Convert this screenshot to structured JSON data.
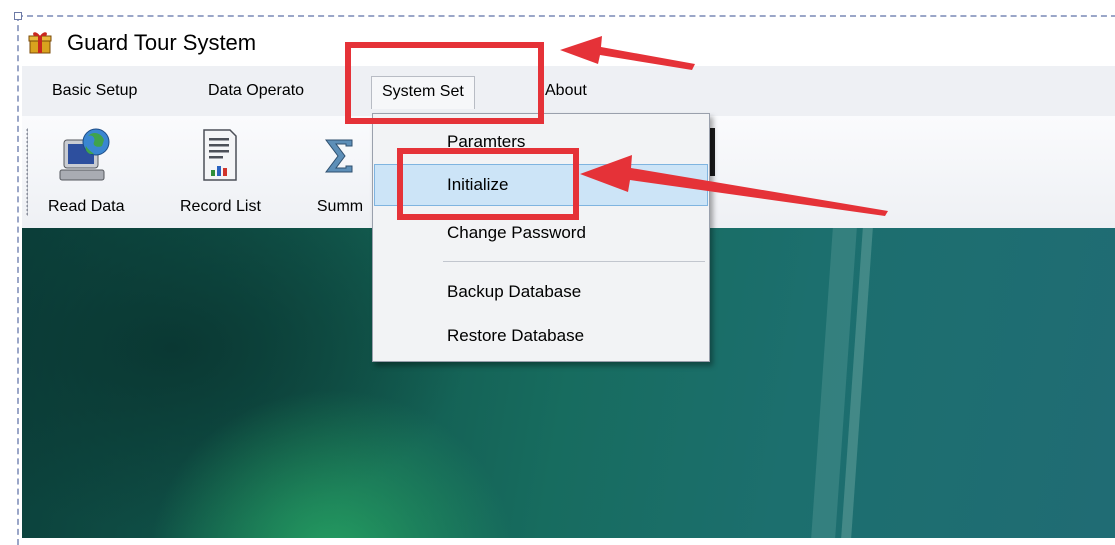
{
  "window": {
    "title": "Guard Tour System",
    "icon": "gift-box-icon"
  },
  "menubar": {
    "items": [
      {
        "label": "Basic Setup"
      },
      {
        "label": "Data Operato"
      },
      {
        "label": "System Set",
        "active": true
      },
      {
        "label": "About"
      }
    ]
  },
  "toolbar": {
    "items": [
      {
        "label": "Read Data",
        "icon": "computer-globe-icon"
      },
      {
        "label": "Record List",
        "icon": "report-chart-icon"
      },
      {
        "label": "Summ",
        "icon": "sigma-icon"
      }
    ]
  },
  "dropdown": {
    "items": [
      {
        "label": "Paramters"
      },
      {
        "label": "Initialize",
        "highlighted": true
      },
      {
        "label": "Change Password"
      },
      {
        "label": "Backup Database"
      },
      {
        "label": "Restore Database"
      }
    ]
  },
  "annotations": {
    "highlight_color": "#e53238",
    "highlighted_targets": [
      "System Set",
      "Initialize"
    ]
  },
  "colors": {
    "menu_highlight": "#cce4f7",
    "background_dark": "#0b3f3a",
    "background_light": "#206c74"
  }
}
